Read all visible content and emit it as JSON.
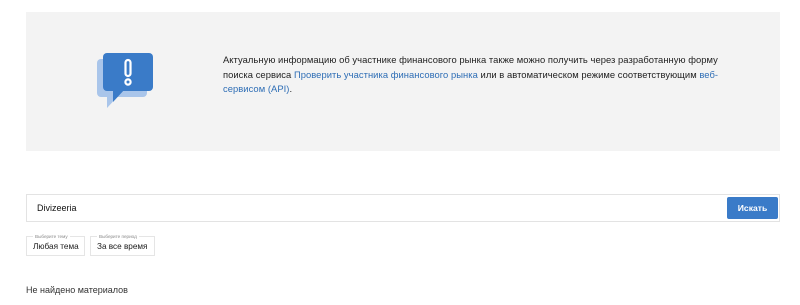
{
  "notice": {
    "icon": "exclamation-speech-bubble-icon",
    "text_before": "Актуальную информацию об участнике финансового рынка также можно получить через разработанную форму поиска сервиса ",
    "link1_label": "Проверить участника финансового рынка",
    "text_middle": " или в автоматическом режиме соответствующим ",
    "link2_label": "веб-сервисом (API)",
    "text_after": ".",
    "colors": {
      "background": "#f3f3f3",
      "link": "#2d6db5",
      "icon_front": "#3a7bc8",
      "icon_back": "#a9c5ea"
    }
  },
  "search": {
    "value": "Divizeeria",
    "button_label": "Искать",
    "button_color": "#3a7bc8"
  },
  "filters": {
    "topic": {
      "caption": "Выберите тему",
      "value": "Любая тема"
    },
    "period": {
      "caption": "Выберите период",
      "value": "За все время"
    }
  },
  "results": {
    "message": "Не найдено материалов"
  }
}
